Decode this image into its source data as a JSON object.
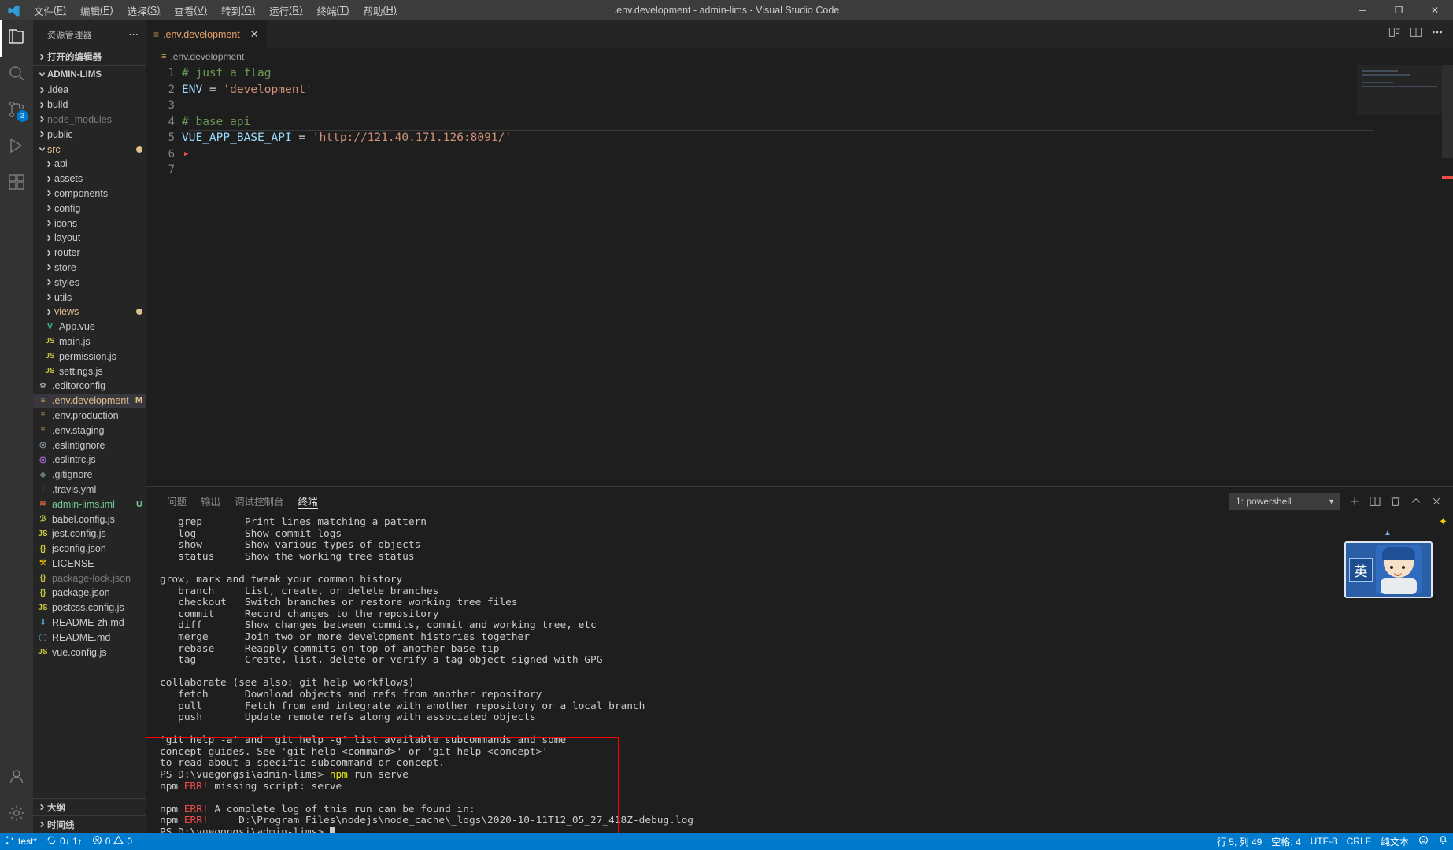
{
  "window": {
    "title": ".env.development - admin-lims - Visual Studio Code",
    "minimize": "─",
    "maximize": "❐",
    "close": "✕"
  },
  "menu": [
    {
      "label": "文件",
      "accel": "(F)"
    },
    {
      "label": "编辑",
      "accel": "(E)"
    },
    {
      "label": "选择",
      "accel": "(S)"
    },
    {
      "label": "查看",
      "accel": "(V)"
    },
    {
      "label": "转到",
      "accel": "(G)"
    },
    {
      "label": "运行",
      "accel": "(R)"
    },
    {
      "label": "终端",
      "accel": "(T)"
    },
    {
      "label": "帮助",
      "accel": "(H)"
    }
  ],
  "activitybar": {
    "items": [
      {
        "name": "explorer",
        "badge": ""
      },
      {
        "name": "search",
        "badge": ""
      },
      {
        "name": "source-control",
        "badge": "3"
      },
      {
        "name": "run-and-debug",
        "badge": ""
      },
      {
        "name": "extensions",
        "badge": ""
      }
    ],
    "accounts": "accounts",
    "settings": "settings"
  },
  "sidebar": {
    "title": "资源管理器",
    "open_editors": "打开的编辑器",
    "project": "ADMIN-LIMS",
    "outline": "大纲",
    "timeline": "时间线",
    "tree": [
      {
        "label": ".idea",
        "type": "folder",
        "indent": 1,
        "expanded": false,
        "color": "#cccccc",
        "icon": "",
        "badge": ""
      },
      {
        "label": "build",
        "type": "folder",
        "indent": 1,
        "expanded": false,
        "color": "#cccccc",
        "icon": "",
        "badge": ""
      },
      {
        "label": "node_modules",
        "type": "folder",
        "indent": 1,
        "expanded": false,
        "color": "#7a7a7a",
        "icon": "",
        "badge": ""
      },
      {
        "label": "public",
        "type": "folder",
        "indent": 1,
        "expanded": false,
        "color": "#cccccc",
        "icon": "",
        "badge": ""
      },
      {
        "label": "src",
        "type": "folder",
        "indent": 1,
        "expanded": true,
        "color": "#e2c08d",
        "icon": "",
        "badge": "dot"
      },
      {
        "label": "api",
        "type": "folder",
        "indent": 2,
        "expanded": false,
        "color": "#cccccc",
        "icon": "",
        "badge": ""
      },
      {
        "label": "assets",
        "type": "folder",
        "indent": 2,
        "expanded": false,
        "color": "#cccccc",
        "icon": "",
        "badge": ""
      },
      {
        "label": "components",
        "type": "folder",
        "indent": 2,
        "expanded": false,
        "color": "#cccccc",
        "icon": "",
        "badge": ""
      },
      {
        "label": "config",
        "type": "folder",
        "indent": 2,
        "expanded": false,
        "color": "#cccccc",
        "icon": "",
        "badge": ""
      },
      {
        "label": "icons",
        "type": "folder",
        "indent": 2,
        "expanded": false,
        "color": "#cccccc",
        "icon": "",
        "badge": ""
      },
      {
        "label": "layout",
        "type": "folder",
        "indent": 2,
        "expanded": false,
        "color": "#cccccc",
        "icon": "",
        "badge": ""
      },
      {
        "label": "router",
        "type": "folder",
        "indent": 2,
        "expanded": false,
        "color": "#cccccc",
        "icon": "",
        "badge": ""
      },
      {
        "label": "store",
        "type": "folder",
        "indent": 2,
        "expanded": false,
        "color": "#cccccc",
        "icon": "",
        "badge": ""
      },
      {
        "label": "styles",
        "type": "folder",
        "indent": 2,
        "expanded": false,
        "color": "#cccccc",
        "icon": "",
        "badge": ""
      },
      {
        "label": "utils",
        "type": "folder",
        "indent": 2,
        "expanded": false,
        "color": "#cccccc",
        "icon": "",
        "badge": ""
      },
      {
        "label": "views",
        "type": "folder",
        "indent": 2,
        "expanded": false,
        "color": "#e2c08d",
        "icon": "",
        "badge": "dot"
      },
      {
        "label": "App.vue",
        "type": "file",
        "indent": 2,
        "color": "#cccccc",
        "icon": "V",
        "iconcolor": "#41b883",
        "badge": ""
      },
      {
        "label": "main.js",
        "type": "file",
        "indent": 2,
        "color": "#cccccc",
        "icon": "JS",
        "iconcolor": "#cbcb41",
        "badge": ""
      },
      {
        "label": "permission.js",
        "type": "file",
        "indent": 2,
        "color": "#cccccc",
        "icon": "JS",
        "iconcolor": "#cbcb41",
        "badge": ""
      },
      {
        "label": "settings.js",
        "type": "file",
        "indent": 2,
        "color": "#cccccc",
        "icon": "JS",
        "iconcolor": "#cbcb41",
        "badge": ""
      },
      {
        "label": ".editorconfig",
        "type": "file",
        "indent": 1,
        "color": "#cccccc",
        "icon": "⚙",
        "iconcolor": "#9aa5ab",
        "badge": ""
      },
      {
        "label": ".env.development",
        "type": "file",
        "indent": 1,
        "color": "#e2c08d",
        "icon": "≡",
        "iconcolor": "#c09553",
        "badge": "M",
        "badgecolor": "#e2c08d",
        "selected": true
      },
      {
        "label": ".env.production",
        "type": "file",
        "indent": 1,
        "color": "#cccccc",
        "icon": "≡",
        "iconcolor": "#c09553",
        "badge": ""
      },
      {
        "label": ".env.staging",
        "type": "file",
        "indent": 1,
        "color": "#cccccc",
        "icon": "≡",
        "iconcolor": "#c09553",
        "badge": ""
      },
      {
        "label": ".eslintignore",
        "type": "file",
        "indent": 1,
        "color": "#cccccc",
        "icon": "◎",
        "iconcolor": "#8a9aa0",
        "badge": ""
      },
      {
        "label": ".eslintrc.js",
        "type": "file",
        "indent": 1,
        "color": "#cccccc",
        "icon": "◎",
        "iconcolor": "#b36fe0",
        "badge": ""
      },
      {
        "label": ".gitignore",
        "type": "file",
        "indent": 1,
        "color": "#cccccc",
        "icon": "◈",
        "iconcolor": "#6d8086",
        "badge": ""
      },
      {
        "label": ".travis.yml",
        "type": "file",
        "indent": 1,
        "color": "#cccccc",
        "icon": "!",
        "iconcolor": "#d44a7a",
        "badge": ""
      },
      {
        "label": "admin-lims.iml",
        "type": "file",
        "indent": 1,
        "color": "#73c991",
        "icon": "≋",
        "iconcolor": "#cc6633",
        "badge": "U",
        "badgecolor": "#73c991"
      },
      {
        "label": "babel.config.js",
        "type": "file",
        "indent": 1,
        "color": "#cccccc",
        "icon": "ℬ",
        "iconcolor": "#cbcb41",
        "badge": ""
      },
      {
        "label": "jest.config.js",
        "type": "file",
        "indent": 1,
        "color": "#cccccc",
        "icon": "JS",
        "iconcolor": "#cbcb41",
        "badge": ""
      },
      {
        "label": "jsconfig.json",
        "type": "file",
        "indent": 1,
        "color": "#cccccc",
        "icon": "{}",
        "iconcolor": "#cbcb41",
        "badge": ""
      },
      {
        "label": "LICENSE",
        "type": "file",
        "indent": 1,
        "color": "#cccccc",
        "icon": "⚒",
        "iconcolor": "#d4b106",
        "badge": ""
      },
      {
        "label": "package-lock.json",
        "type": "file",
        "indent": 1,
        "color": "#7a7a7a",
        "icon": "{}",
        "iconcolor": "#cbcb41",
        "badge": ""
      },
      {
        "label": "package.json",
        "type": "file",
        "indent": 1,
        "color": "#cccccc",
        "icon": "{}",
        "iconcolor": "#cbcb41",
        "badge": ""
      },
      {
        "label": "postcss.config.js",
        "type": "file",
        "indent": 1,
        "color": "#cccccc",
        "icon": "JS",
        "iconcolor": "#cbcb41",
        "badge": ""
      },
      {
        "label": "README-zh.md",
        "type": "file",
        "indent": 1,
        "color": "#cccccc",
        "icon": "⬇",
        "iconcolor": "#519aba",
        "badge": ""
      },
      {
        "label": "README.md",
        "type": "file",
        "indent": 1,
        "color": "#cccccc",
        "icon": "ⓘ",
        "iconcolor": "#519aba",
        "badge": ""
      },
      {
        "label": "vue.config.js",
        "type": "file",
        "indent": 1,
        "color": "#cccccc",
        "icon": "JS",
        "iconcolor": "#cbcb41",
        "badge": ""
      }
    ]
  },
  "editor": {
    "tab_label": ".env.development",
    "tab_close": "✕",
    "breadcrumb": ".env.development",
    "lines": [
      {
        "n": "1",
        "tokens": [
          {
            "t": "# just a flag",
            "c": "tk-com"
          }
        ]
      },
      {
        "n": "2",
        "tokens": [
          {
            "t": "ENV",
            "c": "tk-key"
          },
          {
            "t": " = ",
            "c": "tk-op"
          },
          {
            "t": "'development'",
            "c": "tk-str"
          }
        ]
      },
      {
        "n": "3",
        "tokens": []
      },
      {
        "n": "4",
        "tokens": [
          {
            "t": "# base api",
            "c": "tk-com"
          }
        ]
      },
      {
        "n": "5",
        "current": true,
        "tokens": [
          {
            "t": "VUE_APP_BASE_API",
            "c": "tk-key"
          },
          {
            "t": " = ",
            "c": "tk-op"
          },
          {
            "t": "'",
            "c": "tk-str"
          },
          {
            "t": "http://121.40.171.126:8091/",
            "c": "tk-url"
          },
          {
            "t": "'",
            "c": "tk-str"
          }
        ]
      },
      {
        "n": "6",
        "tokens": []
      },
      {
        "n": "7",
        "tokens": []
      }
    ]
  },
  "panel": {
    "tabs": [
      {
        "label": "问题",
        "active": false
      },
      {
        "label": "输出",
        "active": false
      },
      {
        "label": "调试控制台",
        "active": false
      },
      {
        "label": "终端",
        "active": true
      }
    ],
    "terminal_select": "1: powershell",
    "actions": {
      "new": "+",
      "split": "split",
      "kill": "trash",
      "maximize": "chevron-up",
      "close": "✕"
    },
    "terminal_lines": [
      {
        "t": "   grep       Print lines matching a pattern"
      },
      {
        "t": "   log        Show commit logs"
      },
      {
        "t": "   show       Show various types of objects"
      },
      {
        "t": "   status     Show the working tree status"
      },
      {
        "t": ""
      },
      {
        "t": "grow, mark and tweak your common history"
      },
      {
        "t": "   branch     List, create, or delete branches"
      },
      {
        "t": "   checkout   Switch branches or restore working tree files"
      },
      {
        "t": "   commit     Record changes to the repository"
      },
      {
        "t": "   diff       Show changes between commits, commit and working tree, etc"
      },
      {
        "t": "   merge      Join two or more development histories together"
      },
      {
        "t": "   rebase     Reapply commits on top of another base tip"
      },
      {
        "t": "   tag        Create, list, delete or verify a tag object signed with GPG"
      },
      {
        "t": ""
      },
      {
        "t": "collaborate (see also: git help workflows)"
      },
      {
        "t": "   fetch      Download objects and refs from another repository"
      },
      {
        "t": "   pull       Fetch from and integrate with another repository or a local branch"
      },
      {
        "t": "   push       Update remote refs along with associated objects"
      },
      {
        "t": ""
      },
      {
        "t": "'git help -a' and 'git help -g' list available subcommands and some"
      },
      {
        "t": "concept guides. See 'git help <command>' or 'git help <concept>'"
      },
      {
        "t": "to read about a specific subcommand or concept."
      }
    ],
    "prompt_line": "PS D:\\vuegongsi\\admin-lims> ",
    "prompt_cmd_pre": "npm",
    "prompt_cmd_post": " run serve",
    "err_lines": [
      {
        "pre": "npm ",
        "err": "ERR!",
        "post": " missing script: serve"
      },
      {
        "pre": "",
        "err": "",
        "post": ""
      },
      {
        "pre": "npm ",
        "err": "ERR!",
        "post": " A complete log of this run can be found in:"
      },
      {
        "pre": "npm ",
        "err": "ERR!",
        "post": "     D:\\Program Files\\nodejs\\node_cache\\_logs\\2020-10-11T12_05_27_418Z-debug.log"
      }
    ],
    "final_prompt": "PS D:\\vuegongsi\\admin-lims> "
  },
  "statusbar": {
    "branch": "test*",
    "sync": "0↓ 1↑",
    "errors": "0",
    "warnings": "0",
    "cursor": "行 5, 列 49",
    "spaces": "空格: 4",
    "encoding": "UTF-8",
    "eol": "CRLF",
    "language": "纯文本",
    "feedback": "smiley",
    "bell": "bell"
  }
}
